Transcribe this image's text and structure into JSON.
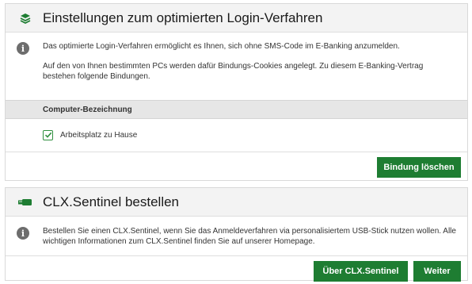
{
  "login_settings": {
    "title": "Einstellungen zum optimierten Login-Verfahren",
    "header_icon": "stacked-layers-icon",
    "info_icon": "info-icon",
    "paragraph1": "Das optimierte Login-Verfahren ermöglicht es Ihnen, sich ohne SMS-Code im E-Banking anzumelden.",
    "paragraph2": "Auf den von Ihnen bestimmten PCs werden dafür Bindungs-Cookies angelegt. Zu diesem E-Banking-Vertrag bestehen folgende Bindungen.",
    "table": {
      "column_header": "Computer-Bezeichnung",
      "rows": [
        {
          "label": "Arbeitsplatz zu Hause",
          "checked": true
        }
      ]
    },
    "delete_button": "Bindung löschen"
  },
  "sentinel": {
    "title": "CLX.Sentinel bestellen",
    "header_icon": "usb-stick-icon",
    "info_icon": "info-icon",
    "paragraph": "Bestellen Sie einen CLX.Sentinel, wenn Sie das Anmeldeverfahren via personalisiertem USB-Stick nutzen wollen. Alle wichtigen Informationen zum CLX.Sentinel finden Sie auf unserer Homepage.",
    "about_button": "Über CLX.Sentinel",
    "next_button": "Weiter"
  },
  "colors": {
    "accent": "#1e7d32",
    "header_bg": "#f3f3f3",
    "table_header_bg": "#e6e6e6",
    "border": "#d9d9d9"
  }
}
